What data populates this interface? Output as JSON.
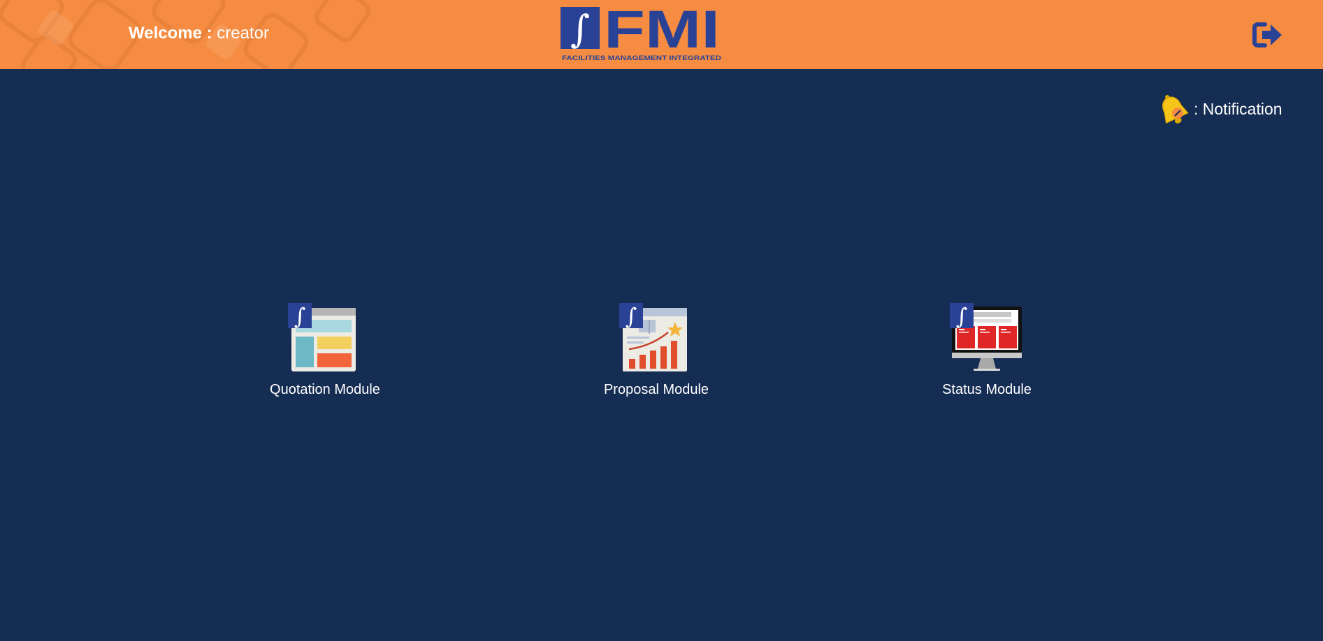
{
  "header": {
    "welcome_label": "Welcome :",
    "username": "creator",
    "logo": {
      "text": "FMI",
      "tagline": "FACILITIES  MANAGEMENT  INTEGRATED",
      "symbol": "∫"
    },
    "logout_icon": "logout-icon"
  },
  "notification": {
    "icon": "bell-icon",
    "label": ": Notification"
  },
  "modules": [
    {
      "label": "Quotation Module",
      "icon": "quotation-module-icon"
    },
    {
      "label": "Proposal Module",
      "icon": "proposal-module-icon"
    },
    {
      "label": "Status Module",
      "icon": "status-module-icon"
    }
  ],
  "colors": {
    "header_bg": "#f58c41",
    "page_bg": "#152c53",
    "brand_blue": "#2a4296",
    "text": "#ffffff"
  }
}
